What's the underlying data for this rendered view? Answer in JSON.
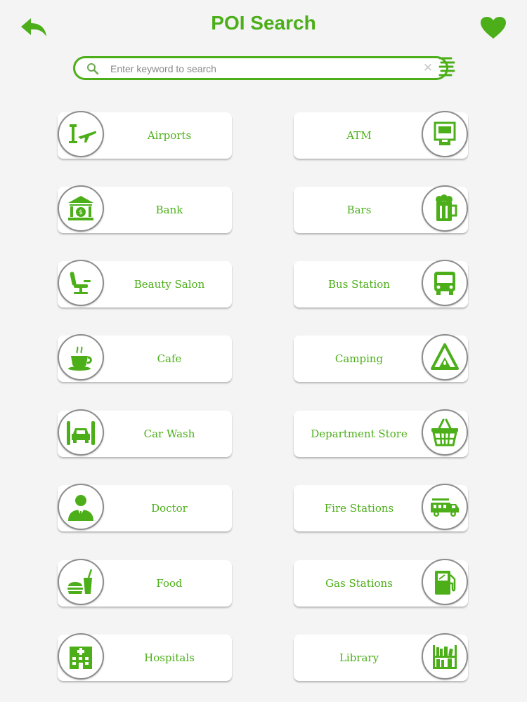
{
  "header": {
    "title": "POI Search",
    "back_icon": "back-arrow-icon",
    "favorite_icon": "heart-icon"
  },
  "search": {
    "placeholder": "Enter keyword to search",
    "value": "",
    "clear_icon": "clear-icon",
    "search_icon": "search-icon"
  },
  "accent_color": "#4caf1a",
  "categories": [
    {
      "label": "Airports",
      "icon": "airport-icon"
    },
    {
      "label": "ATM",
      "icon": "atm-icon"
    },
    {
      "label": "Bank",
      "icon": "bank-icon"
    },
    {
      "label": "Bars",
      "icon": "beer-mug-icon"
    },
    {
      "label": "Beauty Salon",
      "icon": "salon-chair-icon"
    },
    {
      "label": "Bus Station",
      "icon": "bus-icon"
    },
    {
      "label": "Cafe",
      "icon": "coffee-cup-icon"
    },
    {
      "label": "Camping",
      "icon": "tent-icon"
    },
    {
      "label": "Car Wash",
      "icon": "car-wash-icon"
    },
    {
      "label": "Department Store",
      "icon": "shopping-basket-icon"
    },
    {
      "label": "Doctor",
      "icon": "doctor-icon"
    },
    {
      "label": "Fire Stations",
      "icon": "fire-truck-icon"
    },
    {
      "label": "Food",
      "icon": "burger-drink-icon"
    },
    {
      "label": "Gas Stations",
      "icon": "fuel-pump-icon"
    },
    {
      "label": "Hospitals",
      "icon": "hospital-building-icon"
    },
    {
      "label": "Library",
      "icon": "bookshelf-icon"
    }
  ]
}
